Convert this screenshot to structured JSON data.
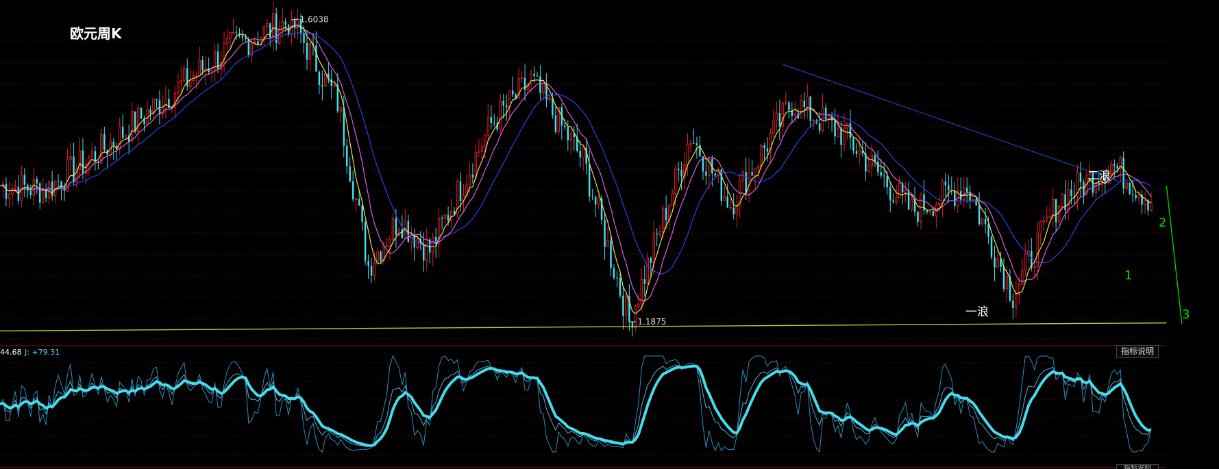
{
  "title": "欧元周K",
  "high_label": "1.6038",
  "low_label": "1.1875",
  "wave_labels": {
    "wave1": "一浪",
    "wave2": "二浪"
  },
  "count_labels": {
    "c1": "1",
    "c2": "2",
    "c3": "3"
  },
  "indicator": {
    "readout_k_tail": "44.68",
    "readout_j": "J: +79.31",
    "help_button": "指标说明"
  },
  "colors": {
    "background": "#000000",
    "candle_up": "#e02020",
    "candle_down": "#40e0ee",
    "ma_fast": "#e8e060",
    "ma_mid": "#e060e0",
    "ma_slow": "#3040f0",
    "trend_line": "#2040c0",
    "support_line": "#d0c030",
    "count_green": "#00e000",
    "kdj_main": "#44ddee"
  },
  "chart_data": [
    {
      "type": "candlestick",
      "title": "欧元周K",
      "ylim": [
        1.18,
        1.61
      ],
      "key_levels": {
        "high": 1.6038,
        "low": 1.1875
      },
      "price_path": [
        {
          "week": 0,
          "price": 1.375
        },
        {
          "week": 15,
          "price": 1.37
        },
        {
          "week": 35,
          "price": 1.43
        },
        {
          "week": 55,
          "price": 1.5
        },
        {
          "week": 75,
          "price": 1.565
        },
        {
          "week": 95,
          "price": 1.603
        },
        {
          "week": 110,
          "price": 1.49
        },
        {
          "week": 120,
          "price": 1.265
        },
        {
          "week": 130,
          "price": 1.33
        },
        {
          "week": 140,
          "price": 1.285
        },
        {
          "week": 160,
          "price": 1.46
        },
        {
          "week": 173,
          "price": 1.52
        },
        {
          "week": 190,
          "price": 1.41
        },
        {
          "week": 205,
          "price": 1.1875
        },
        {
          "week": 225,
          "price": 1.445
        },
        {
          "week": 238,
          "price": 1.35
        },
        {
          "week": 258,
          "price": 1.49
        },
        {
          "week": 275,
          "price": 1.445
        },
        {
          "week": 297,
          "price": 1.34
        },
        {
          "week": 315,
          "price": 1.375
        },
        {
          "week": 330,
          "price": 1.225
        },
        {
          "week": 345,
          "price": 1.355
        },
        {
          "week": 362,
          "price": 1.405
        },
        {
          "week": 375,
          "price": 1.355
        }
      ],
      "trend_line": {
        "from": {
          "week": 255,
          "price": 1.542
        },
        "to": {
          "week": 365,
          "price": 1.38
        }
      },
      "support_line": {
        "from": {
          "week": 0,
          "price": 1.175
        },
        "to": {
          "week": 380,
          "price": 1.186
        }
      },
      "projection_line": {
        "from": {
          "week": 380,
          "price": 1.375
        },
        "to": {
          "week": 385,
          "price": 1.185
        }
      }
    },
    {
      "type": "line",
      "indicator": "KDJ",
      "ylim": [
        0,
        100
      ],
      "readouts": {
        "K_tail": 44.68,
        "J": 79.31
      }
    }
  ]
}
